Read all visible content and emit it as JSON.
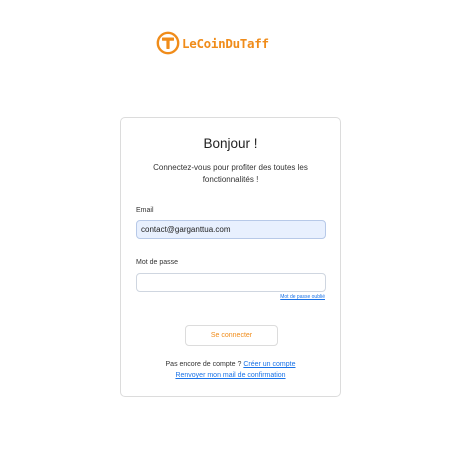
{
  "brand": {
    "name": "LeCoinDuTaff",
    "accent": "#f08c1a",
    "icon": "hammer-t-icon"
  },
  "login": {
    "title": "Bonjour !",
    "subtitle": "Connectez-vous pour profiter des toutes les fonctionnalités !",
    "email_label": "Email",
    "email_value": "contact@garganttua.com",
    "password_label": "Mot de passe",
    "password_value": "",
    "forgot_link": "Mot de passe oublié",
    "submit_label": "Se connecter",
    "no_account_text": "Pas encore de compte ? ",
    "create_account_link": "Créer un compte",
    "resend_link": "Renvoyer mon mail de confirmation"
  },
  "colors": {
    "link": "#1a73e8",
    "autofill_bg": "#e8f0fe"
  }
}
